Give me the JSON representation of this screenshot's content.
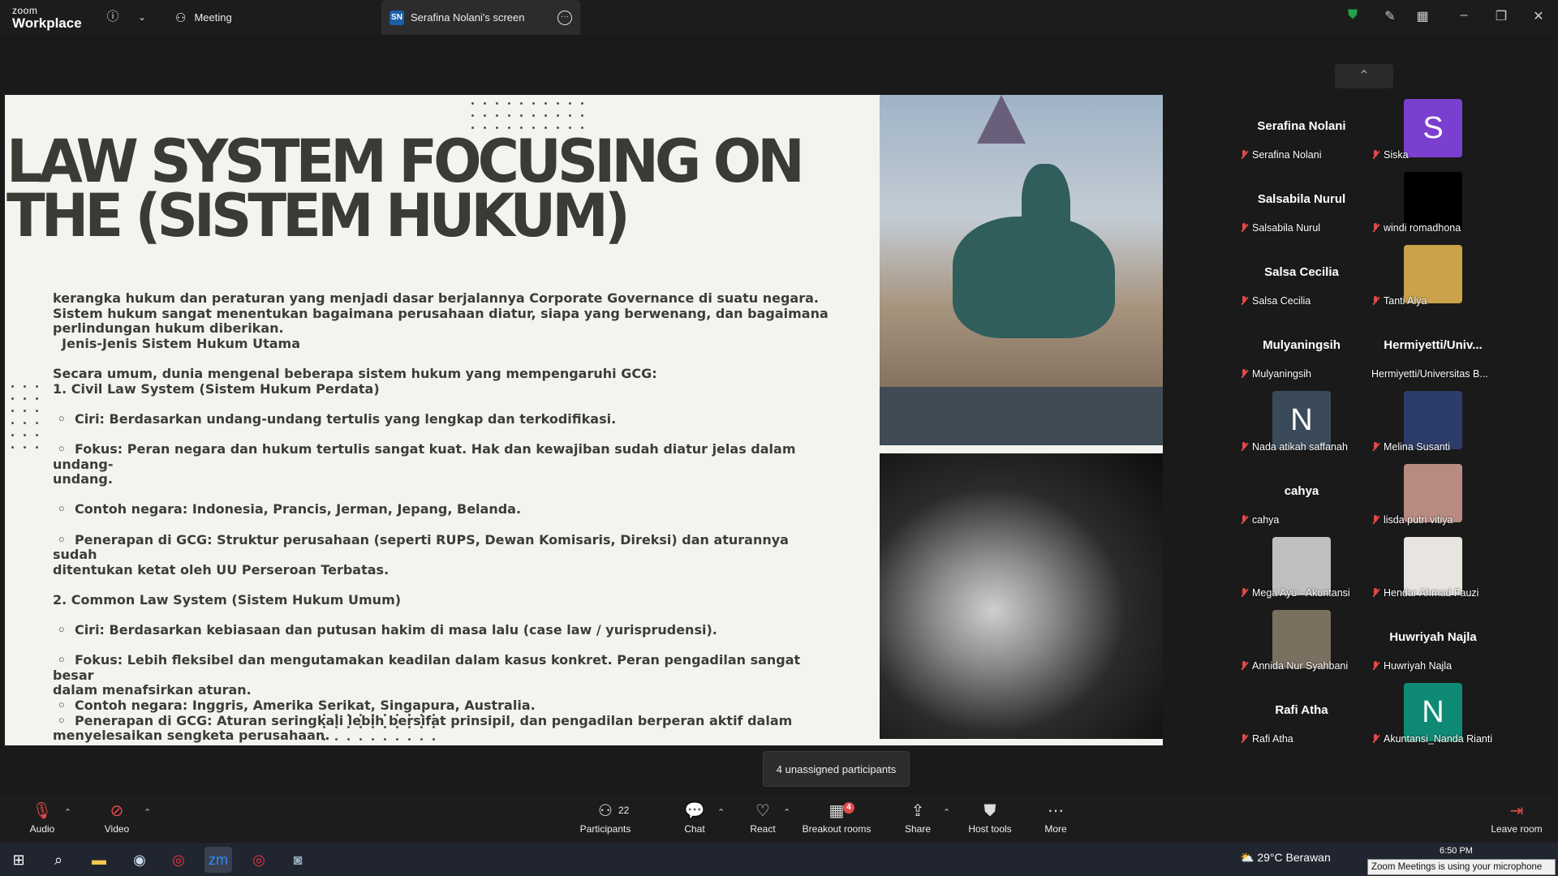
{
  "app": {
    "logo_line1": "zoom",
    "logo_line2": "Workplace"
  },
  "tabs": {
    "meeting_label": "Meeting",
    "screen_badge": "SN",
    "screen_label": "Serafina Nolani's screen"
  },
  "slide": {
    "title": "LAW SYSTEM FOCUSING ON\nTHE (SISTEM HUKUM)",
    "body": "kerangka hukum dan peraturan yang menjadi dasar berjalannya Corporate Governance di suatu negara.\nSistem hukum sangat menentukan bagaimana perusahaan diatur, siapa yang berwenang, dan bagaimana\nperlindungan hukum diberikan.\n  Jenis-Jenis Sistem Hukum Utama\n\nSecara umum, dunia mengenal beberapa sistem hukum yang mempengaruhi GCG:\n1. Civil Law System (Sistem Hukum Perdata)\n\n ◦  Ciri: Berdasarkan undang-undang tertulis yang lengkap dan terkodifikasi.\n\n ◦  Fokus: Peran negara dan hukum tertulis sangat kuat. Hak dan kewajiban sudah diatur jelas dalam undang-\nundang.\n\n ◦  Contoh negara: Indonesia, Prancis, Jerman, Jepang, Belanda.\n\n ◦  Penerapan di GCG: Struktur perusahaan (seperti RUPS, Dewan Komisaris, Direksi) dan aturannya sudah\nditentukan ketat oleh UU Perseroan Terbatas.\n\n2. Common Law System (Sistem Hukum Umum)\n\n ◦  Ciri: Berdasarkan kebiasaan dan putusan hakim di masa lalu (case law / yurisprudensi).\n\n ◦  Fokus: Lebih fleksibel dan mengutamakan keadilan dalam kasus konkret. Peran pengadilan sangat besar\ndalam menafsirkan aturan.\n ◦  Contoh negara: Inggris, Amerika Serikat, Singapura, Australia.\n ◦  Penerapan di GCG: Aturan seringkali lebih bersifat prinsipil, dan pengadilan berperan aktif dalam\nmenyelesaikan sengketa perusahaan."
  },
  "gallery": {
    "tiles": [
      {
        "big_name": "Serafina Nolani",
        "label": "Serafina Nolani",
        "muted": true
      },
      {
        "avatar_letter": "S",
        "avatar_color": "#7b3fd0",
        "label": "Siska",
        "muted": true
      },
      {
        "big_name": "Salsabila Nurul",
        "label": "Salsabila Nurul",
        "muted": true
      },
      {
        "avatar_color": "#000000",
        "label": "windi romadhona",
        "muted": true
      },
      {
        "big_name": "Salsa Cecilia",
        "label": "Salsa Cecilia",
        "muted": true
      },
      {
        "avatar_color": "#c9a24a",
        "label": "Tanti Alya",
        "muted": true
      },
      {
        "big_name": "Mulyaningsih",
        "label": "Mulyaningsih",
        "muted": true
      },
      {
        "big_name": "Hermiyetti/Univ...",
        "label": "Hermiyetti/Universitas B...",
        "muted": false
      },
      {
        "avatar_letter": "N",
        "avatar_color": "#3b4a5a",
        "label": "Nada atikah saffanah",
        "muted": true
      },
      {
        "avatar_color": "#2d3d6b",
        "label": "Melina Susanti",
        "muted": true
      },
      {
        "big_name": "cahya",
        "label": "cahya",
        "muted": true
      },
      {
        "avatar_color": "#b88a80",
        "label": "lisda putri vitiya",
        "muted": true
      },
      {
        "avatar_color": "#bfbfbf",
        "label": "Mega Ayu - Akuntansi",
        "muted": true
      },
      {
        "avatar_color": "#e8e4df",
        "label": "Hendar Ahmad Fauzi",
        "muted": true
      },
      {
        "avatar_color": "#7a7060",
        "label": "Annida Nur Syahbani",
        "muted": true
      },
      {
        "big_name": "Huwriyah Najla",
        "label": "Huwriyah Najla",
        "muted": true
      },
      {
        "big_name": "Rafi Atha",
        "label": "Rafi Atha",
        "muted": true
      },
      {
        "avatar_letter": "N",
        "avatar_color": "#0e8a74",
        "label": "Akuntansi_Nanda Rianti",
        "muted": true
      }
    ]
  },
  "tooltip": "4 unassigned participants",
  "toolbar": {
    "audio": "Audio",
    "video": "Video",
    "participants": "Participants",
    "participants_count": "22",
    "chat": "Chat",
    "react": "React",
    "breakout": "Breakout rooms",
    "breakout_badge": "4",
    "share": "Share",
    "host_tools": "Host tools",
    "more": "More",
    "leave": "Leave room"
  },
  "taskbar": {
    "weather": "29°C  Berawan",
    "time": "6:50 PM",
    "notification": "Zoom Meetings is using your microphone"
  }
}
